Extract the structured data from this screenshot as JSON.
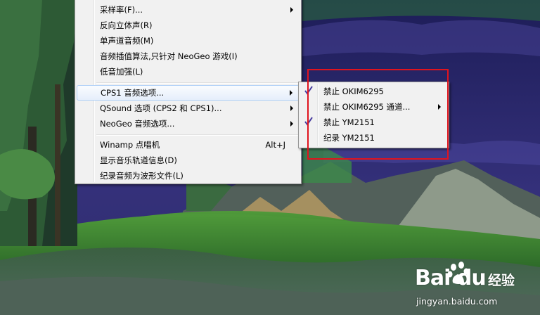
{
  "main_menu": {
    "items": [
      {
        "label": "采样率(F)...",
        "submenu": true
      },
      {
        "label": "反向立体声(R)"
      },
      {
        "label": "单声道音频(M)"
      },
      {
        "label": "音频插值算法,只针对 NeoGeo 游戏(I)"
      },
      {
        "label": "低音加强(L)"
      },
      {
        "label": "CPS1 音频选项...",
        "submenu": true,
        "highlighted": true
      },
      {
        "label": "QSound 选项 (CPS2 和 CPS1)...",
        "submenu": true
      },
      {
        "label": "NeoGeo 音频选项...",
        "submenu": true
      },
      {
        "label": "Winamp 点唱机",
        "accel": "Alt+J"
      },
      {
        "label": "显示音乐轨道信息(D)"
      },
      {
        "label": "纪录音频为波形文件(L)"
      }
    ]
  },
  "sub_menu": {
    "items": [
      {
        "label": "禁止 OKIM6295",
        "checked": true
      },
      {
        "label": "禁止 OKIM6295 通道...",
        "submenu": true
      },
      {
        "label": "禁止 YM2151",
        "checked": true
      },
      {
        "label": "纪录 YM2151"
      }
    ]
  },
  "watermark": {
    "brand": "Bai  du",
    "sub": "经验",
    "url": "jingyan.baidu.com"
  },
  "colors": {
    "check": "#4a3fa0",
    "highlight_box": "#e0141e",
    "menu_bg": "#f1f1f1"
  },
  "icons": [
    "check-icon",
    "submenu-arrow-icon",
    "baidu-paw-icon"
  ]
}
